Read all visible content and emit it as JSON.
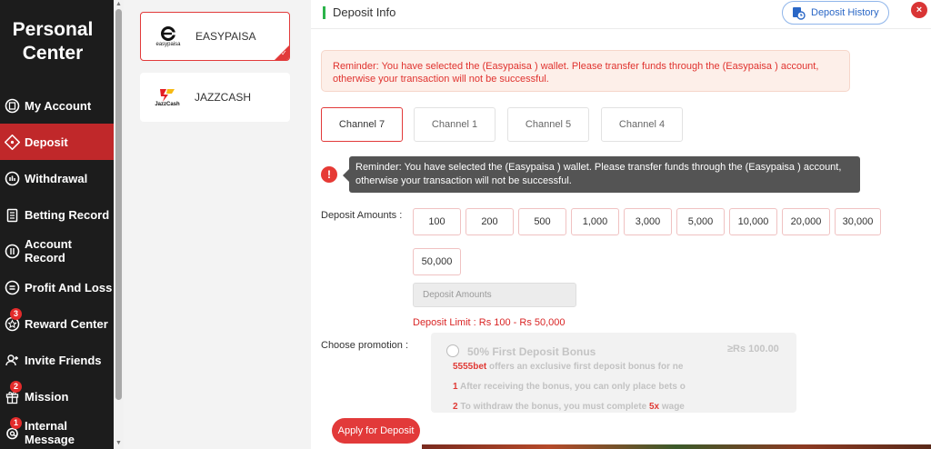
{
  "sidebar": {
    "title": "Personal Center",
    "items": [
      {
        "label": "My Account",
        "icon": "account-icon",
        "badge": null
      },
      {
        "label": "Deposit",
        "icon": "deposit-icon",
        "badge": null,
        "active": true
      },
      {
        "label": "Withdrawal",
        "icon": "withdrawal-icon",
        "badge": null
      },
      {
        "label": "Betting Record",
        "icon": "betting-record-icon",
        "badge": null
      },
      {
        "label": "Account Record",
        "icon": "account-record-icon",
        "badge": null
      },
      {
        "label": "Profit And Loss",
        "icon": "profit-loss-icon",
        "badge": null
      },
      {
        "label": "Reward Center",
        "icon": "reward-icon",
        "badge": "3"
      },
      {
        "label": "Invite Friends",
        "icon": "invite-icon",
        "badge": null
      },
      {
        "label": "Mission",
        "icon": "gift-icon",
        "badge": "2"
      },
      {
        "label": "Internal Message",
        "icon": "message-icon",
        "badge": "1"
      }
    ]
  },
  "wallets": [
    {
      "name": "EASYPAISA",
      "logo_text": "easypaisa",
      "selected": true
    },
    {
      "name": "JAZZCASH",
      "logo_text": "JazzCash",
      "selected": false
    }
  ],
  "header": {
    "title": "Deposit Info",
    "history_label": "Deposit History",
    "close_label": "×"
  },
  "reminder": "Reminder: You have selected the (Easypaisa ) wallet. Please transfer funds through the (Easypaisa ) account, otherwise your transaction will not be successful.",
  "channels": [
    "Channel 7",
    "Channel 1",
    "Channel 5",
    "Channel 4"
  ],
  "tooltip": "Reminder: You have selected the (Easypaisa ) wallet. Please transfer funds through the (Easypaisa ) account, otherwise your transaction will not be successful.",
  "warn_symbol": "!",
  "deposit_amounts_label": "Deposit Amounts :",
  "amounts": [
    "100",
    "200",
    "500",
    "1,000",
    "3,000",
    "5,000",
    "10,000",
    "20,000",
    "30,000",
    "50,000"
  ],
  "amount_placeholder": "Deposit Amounts",
  "deposit_limit": "Deposit Limit : Rs  100  - Rs  50,000",
  "promotion_label": "Choose promotion :",
  "promotion": {
    "title": "50% First Deposit Bonus",
    "amount": "≥Rs  100.00",
    "brand": "5555bet",
    "line1": " offers an exclusive first deposit bonus for ne",
    "num1": "1",
    "line2": " After receiving the bonus, you can only place bets o",
    "num2": "2",
    "line3a": " To withdraw the bonus, you must complete ",
    "line3b": "5x",
    "line3c": " wage"
  },
  "apply_label": "Apply for Deposit",
  "colors": {
    "accent": "#e23a3a",
    "sidebar_bg": "#1c1c1c",
    "active_nav": "#c0282a",
    "link_blue": "#2a67c6"
  }
}
